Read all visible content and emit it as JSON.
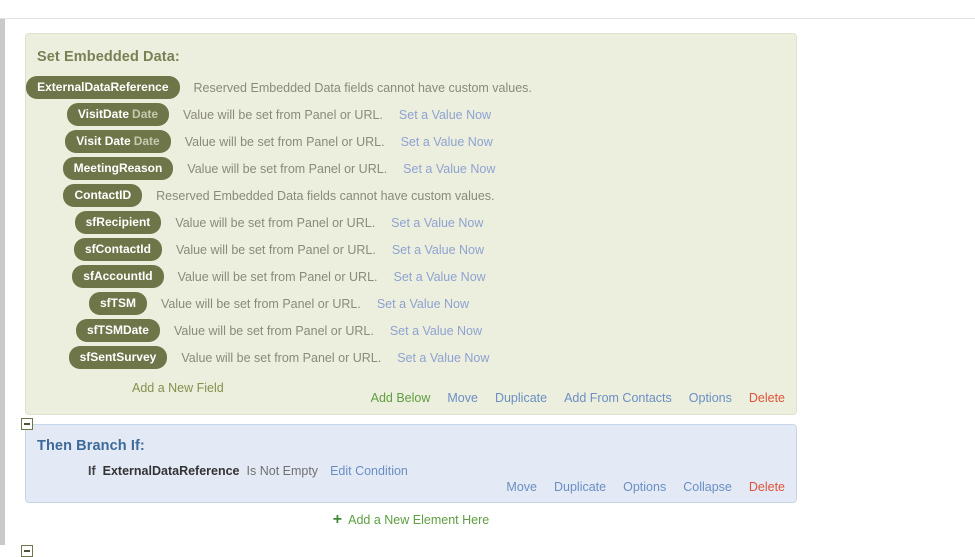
{
  "blocks": {
    "embedded_data": {
      "title": "Set Embedded Data:",
      "fields": [
        {
          "name": "ExternalDataReference",
          "type": "",
          "description": "Reserved Embedded Data fields cannot have custom values.",
          "action": ""
        },
        {
          "name": "VisitDate",
          "type": "Date",
          "description": "Value will be set from Panel or URL.",
          "action": "Set a Value Now"
        },
        {
          "name": "Visit Date",
          "type": "Date",
          "description": "Value will be set from Panel or URL.",
          "action": "Set a Value Now"
        },
        {
          "name": "MeetingReason",
          "type": "",
          "description": "Value will be set from Panel or URL.",
          "action": "Set a Value Now"
        },
        {
          "name": "ContactID",
          "type": "",
          "description": "Reserved Embedded Data fields cannot have custom values.",
          "action": ""
        },
        {
          "name": "sfRecipient",
          "type": "",
          "description": "Value will be set from Panel or URL.",
          "action": "Set a Value Now"
        },
        {
          "name": "sfContactId",
          "type": "",
          "description": "Value will be set from Panel or URL.",
          "action": "Set a Value Now"
        },
        {
          "name": "sfAccountId",
          "type": "",
          "description": "Value will be set from Panel or URL.",
          "action": "Set a Value Now"
        },
        {
          "name": "sfTSM",
          "type": "",
          "description": "Value will be set from Panel or URL.",
          "action": "Set a Value Now"
        },
        {
          "name": "sfTSMDate",
          "type": "",
          "description": "Value will be set from Panel or URL.",
          "action": "Set a Value Now"
        },
        {
          "name": "sfSentSurvey",
          "type": "",
          "description": "Value will be set from Panel or URL.",
          "action": "Set a Value Now"
        }
      ],
      "add_field_label": "Add a New Field",
      "actions": [
        {
          "label": "Add Below",
          "color": "green"
        },
        {
          "label": "Move",
          "color": "blue"
        },
        {
          "label": "Duplicate",
          "color": "blue"
        },
        {
          "label": "Add From Contacts",
          "color": "blue"
        },
        {
          "label": "Options",
          "color": "blue"
        },
        {
          "label": "Delete",
          "color": "red"
        }
      ]
    },
    "branch": {
      "title": "Then Branch If:",
      "condition": {
        "if_label": "If",
        "field": "ExternalDataReference",
        "operator": "Is Not Empty",
        "edit_label": "Edit Condition"
      },
      "actions": [
        {
          "label": "Move",
          "color": "blue"
        },
        {
          "label": "Duplicate",
          "color": "blue"
        },
        {
          "label": "Options",
          "color": "blue"
        },
        {
          "label": "Collapse",
          "color": "blue"
        },
        {
          "label": "Delete",
          "color": "red"
        }
      ]
    }
  },
  "add_element": {
    "plus": "+",
    "label": "Add a New Element Here"
  },
  "colors": {
    "embedded_bg": "#ecefdd",
    "embedded_border": "#dfe3cb",
    "embedded_title": "#7a8055",
    "pill_bg": "#6e7548",
    "branch_bg": "#e3eaf5",
    "branch_border": "#c9d6e8",
    "branch_title": "#3d6a99",
    "link_blue": "#6b8ec4",
    "link_green": "#5f9e42",
    "link_red": "#e0533a",
    "value_link": "#8fa2d2"
  }
}
